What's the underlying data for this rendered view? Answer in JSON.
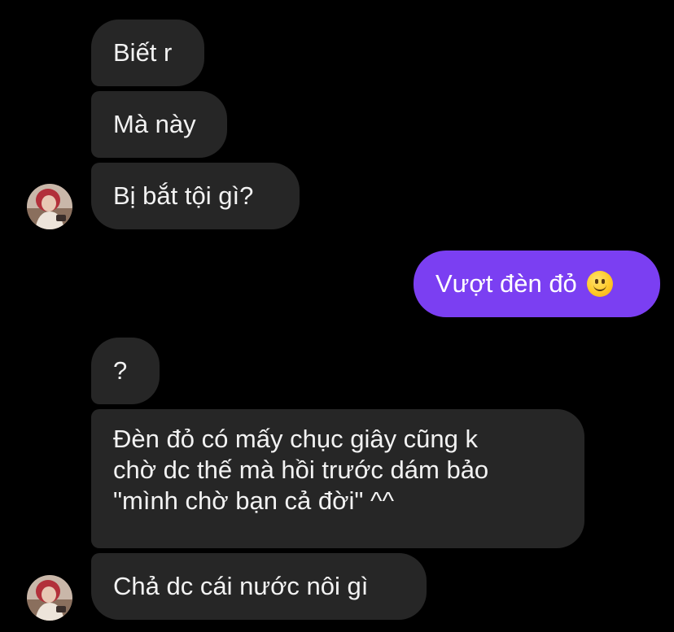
{
  "messages": [
    {
      "id": "m1",
      "side": "incoming",
      "text": "Biết r"
    },
    {
      "id": "m2",
      "side": "incoming",
      "text": "Mà này"
    },
    {
      "id": "m3",
      "side": "incoming",
      "text": "Bị bắt tội gì?"
    },
    {
      "id": "m4",
      "side": "outgoing",
      "text": "Vượt đèn đỏ",
      "emoji": "slightly-smiling-face-icon"
    },
    {
      "id": "m5",
      "side": "incoming",
      "text": "?"
    },
    {
      "id": "m6",
      "side": "incoming",
      "lines": [
        "Đèn đỏ có mấy chục giây cũng k",
        "chờ dc thế mà hồi trước dám bảo",
        "\"mình chờ bạn cả đời\" ^^"
      ]
    },
    {
      "id": "m7",
      "side": "incoming",
      "text": "Chả dc cái nước nôi gì"
    }
  ],
  "colors": {
    "background": "#000000",
    "incoming_bubble": "#262626",
    "outgoing_bubble": "#7b3ff2",
    "text": "#f2f2f2"
  }
}
